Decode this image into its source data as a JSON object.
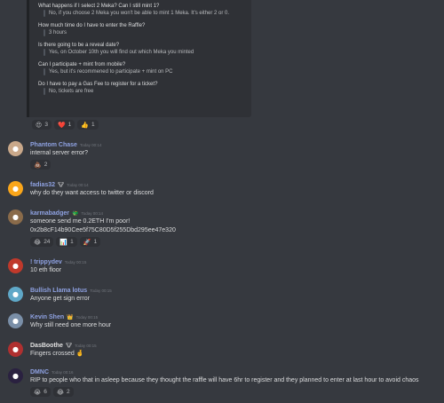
{
  "faq": [
    {
      "q": "What happens if I select 2 Meka? Can I still mint 1?",
      "a": "No, if you choose 2 Meka you won't be able to mint 1 Meka. It's either 2 or 0."
    },
    {
      "q": "How much time do I have to enter the Raffle?",
      "a": "3 hours"
    },
    {
      "q": "Is there going to be a reveal date?",
      "a": "Yes, on October 10th you will find out which Meka you minted"
    },
    {
      "q": "Can I participate + mint from mobile?",
      "a": "Yes, but it's recommened to participate + mint on PC"
    },
    {
      "q": "Do I have to pay a Gas Fee to register for a ticket?",
      "a": "No, tickets are free"
    }
  ],
  "faq_reactions": [
    {
      "emoji": "😍",
      "count": "3"
    },
    {
      "emoji": "❤️",
      "count": "1"
    },
    {
      "emoji": "👍",
      "count": "1"
    }
  ],
  "messages": [
    {
      "author": "Phantom Chase",
      "time": "Today 00:14",
      "text": "internal server error?",
      "name_color": "#8ea1e1",
      "avatar_color": "#c9a88a",
      "avatar_icon": "person-avatar",
      "reactions": [
        {
          "emoji": "💩",
          "count": "2"
        }
      ]
    },
    {
      "author": "fadias32",
      "badge": "🐮",
      "time": "Today 00:14",
      "text": "why do they want access to twitter or discord",
      "name_color": "#8ea1e1",
      "avatar_color": "#faa61a",
      "avatar_icon": "discord-avatar"
    },
    {
      "author": "karmabadger",
      "badge": "🐲",
      "time": "Today 00:14",
      "text": "someone send me 0.2ETH I'm poor!",
      "text2": "0x2b8cF14b90Cee5f75C80D5f255Dbd295ee47e320",
      "name_color": "#8ea1e1",
      "avatar_color": "#8a6b4a",
      "avatar_icon": "badger-avatar",
      "reactions": [
        {
          "emoji": "😂",
          "count": "24"
        },
        {
          "emoji": "📊",
          "count": "1"
        },
        {
          "emoji": "🚀",
          "count": "1"
        }
      ]
    },
    {
      "author": "! trippydev",
      "time": "Today 00:15",
      "text": "10 eth floor",
      "name_color": "#8ea1e1",
      "avatar_color": "#c0392b",
      "avatar_icon": "person-avatar"
    },
    {
      "author": "Bullish Llama lotus",
      "time": "Today 00:15",
      "text": "Anyone get sign error",
      "name_color": "#8ea1e1",
      "avatar_color": "#5fa8c8",
      "avatar_icon": "llama-avatar"
    },
    {
      "author": "Kevin Shen",
      "badge": "👑",
      "time": "Today 00:15",
      "text": "Why  still need one more hour",
      "name_color": "#8ea1e1",
      "avatar_color": "#7a8fa8",
      "avatar_icon": "person-avatar"
    },
    {
      "author": "DasBoothe",
      "badge": "🐮",
      "time": "Today 00:15",
      "text": "Fingers crossed 🤞",
      "name_color": "#e0e0e0",
      "avatar_color": "#b03030",
      "avatar_icon": "person-avatar"
    },
    {
      "author": "DMNC",
      "time": "Today 00:16",
      "text": "RIP to people who that in asleep because they thought the raffle will have 6hr to register and they planned to enter at last hour to avoid chaos",
      "name_color": "#8ea1e1",
      "avatar_color": "#2a2140",
      "avatar_icon": "mask-avatar",
      "reactions": [
        {
          "emoji": "😭",
          "count": "6"
        },
        {
          "emoji": "😂",
          "count": "2"
        }
      ]
    }
  ]
}
